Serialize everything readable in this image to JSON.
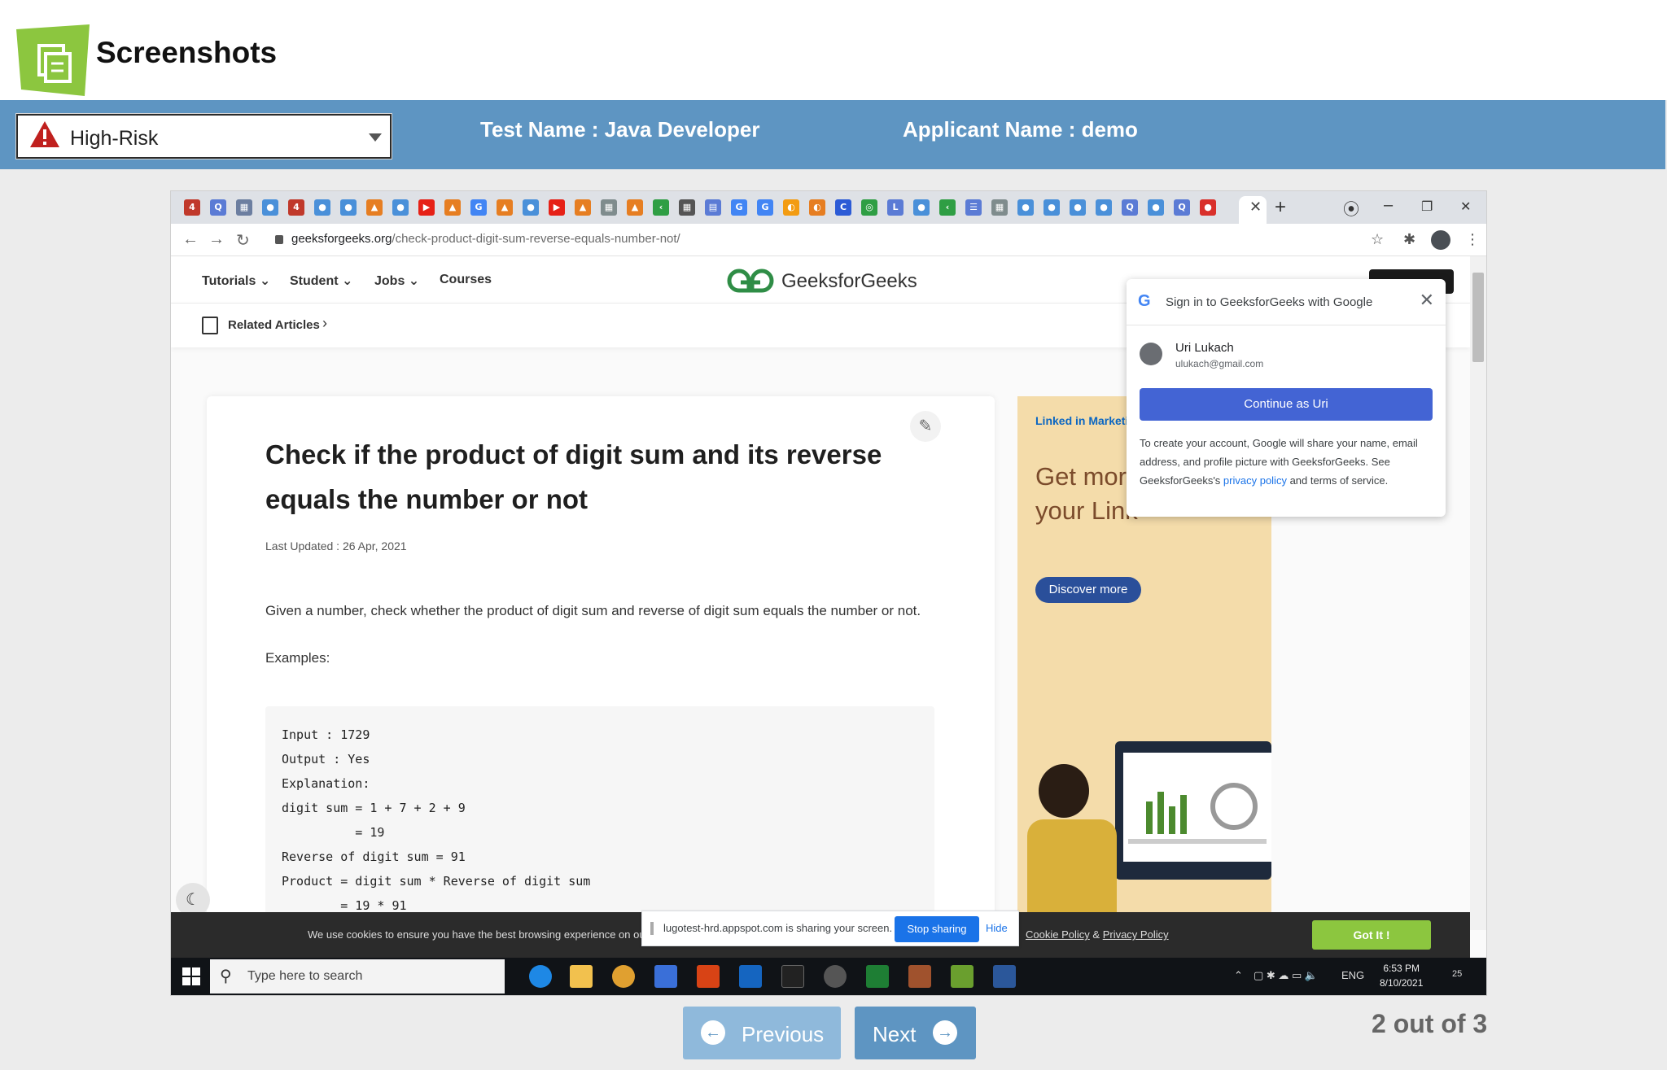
{
  "app": {
    "title": "Screenshots"
  },
  "risk_select": {
    "value": "High-Risk"
  },
  "info": {
    "test_name": "Test Name : Java Developer",
    "applicant_name": "Applicant Name : demo"
  },
  "screenshot": {
    "browser": {
      "url_host": "geeksforgeeks.org",
      "url_path": "/check-product-digit-sum-reverse-equals-number-not/",
      "new_tab": "+",
      "minimize": "–",
      "restore": "❐",
      "close": "✕",
      "back": "←",
      "forward": "→",
      "reload": "↻",
      "star": "☆"
    },
    "site": {
      "nav": [
        "Tutorials",
        "Student",
        "Jobs",
        "Courses"
      ],
      "brand": "GeeksforGeeks",
      "related": "Related Articles"
    },
    "article": {
      "title": "Check if the product of digit sum and its reverse equals the number or not",
      "last_updated": "Last Updated : 26 Apr, 2021",
      "description": "Given a number, check whether the product of digit sum and reverse of digit sum equals the number or not.",
      "examples_label": "Examples:",
      "code": [
        "Input : 1729",
        "Output : Yes",
        "Explanation:",
        "digit sum = 1 + 7 + 2 + 9",
        "          = 19",
        "Reverse of digit sum = 91",
        "Product = digit sum * Reverse of digit sum",
        "        = 19 * 91"
      ]
    },
    "ad": {
      "brand": "Linked in Marketi",
      "headline": "Get mor your Link",
      "cta": "Discover more"
    },
    "google_popup": {
      "title": "Sign in to GeeksforGeeks with Google",
      "user_name": "Uri Lukach",
      "user_email": "ulukach@gmail.com",
      "continue_label": "Continue as Uri",
      "text_before": "To create your account, Google will share your name, email address, and profile picture with GeeksforGeeks. See GeeksforGeeks's",
      "link": "privacy policy",
      "text_after": "and terms of service."
    },
    "cookie": {
      "text": "We use cookies to ensure you have the best browsing experience on our",
      "link_cookie": "Cookie Policy",
      "amp": "&",
      "link_privacy": "Privacy Policy",
      "accept": "Got It !"
    },
    "share_bar": {
      "text": "lugotest-hrd.appspot.com is sharing your screen.",
      "stop": "Stop sharing",
      "hide": "Hide"
    },
    "taskbar": {
      "search_placeholder": "Type here to search",
      "lang": "ENG",
      "time": "6:53 PM",
      "date": "8/10/2021",
      "notif": "25"
    }
  },
  "pagination": {
    "previous": "Previous",
    "next": "Next",
    "counter": "2 out of 3"
  },
  "colors": {
    "bar": "#5e95c2",
    "logo_green": "#8cc63f",
    "risk_red": "#c0201e",
    "google_button": "#4364d4",
    "got_it": "#8cc63f"
  }
}
